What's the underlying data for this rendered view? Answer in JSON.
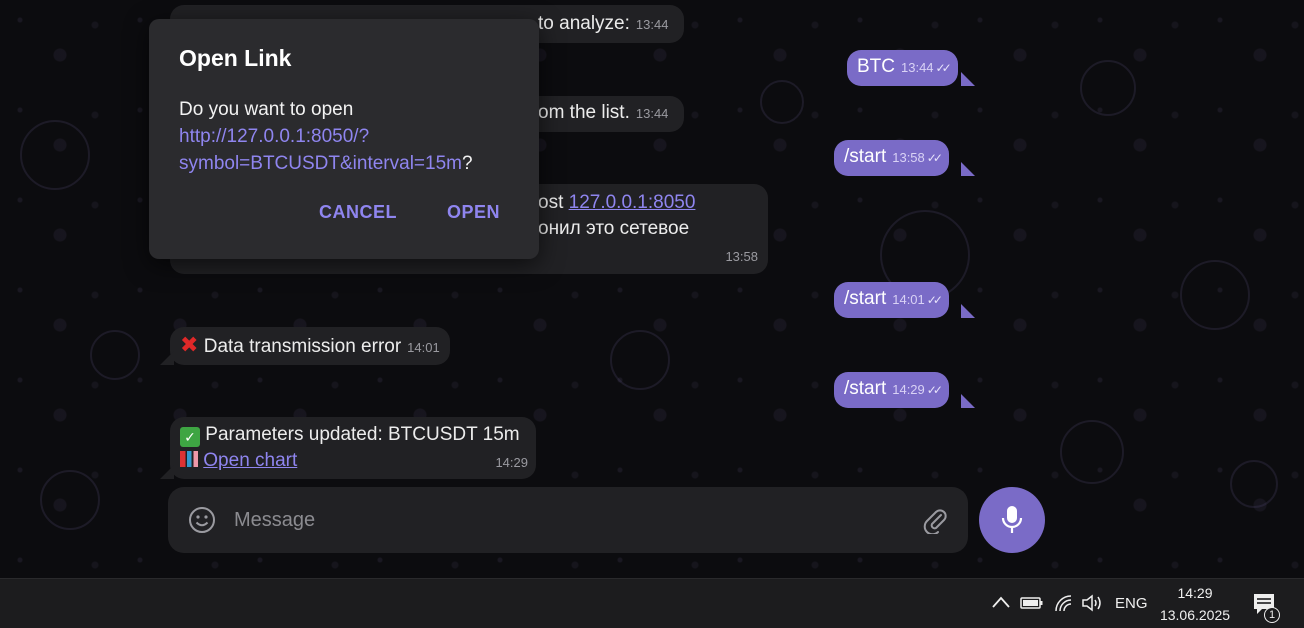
{
  "messages": {
    "top_partial": {
      "text": "to analyze:",
      "time": "13:44"
    },
    "second_partial": {
      "text": "om the list.",
      "time": "13:44"
    },
    "host_msg": {
      "prefix": "ost ",
      "link": "127.0.0.1:8050",
      "line2": "онил это сетевое",
      "time": "13:58"
    },
    "out_btc": {
      "text": "BTC",
      "time": "13:44"
    },
    "out_start1": {
      "text": "/start",
      "time": "13:58"
    },
    "out_start2": {
      "text": "/start",
      "time": "14:01"
    },
    "out_start3": {
      "text": "/start",
      "time": "14:29"
    },
    "error": {
      "text": "Data transmission error",
      "time": "14:01"
    },
    "params": {
      "line1": "Parameters updated: BTCUSDT 15m",
      "link": "Open chart",
      "time": "14:29"
    }
  },
  "composer": {
    "placeholder": "Message"
  },
  "dialog": {
    "title": "Open Link",
    "question": "Do you want to open",
    "url_line1": "http://127.0.0.1:8050/?",
    "url_line2": "symbol=BTCUSDT&interval=15m",
    "question_mark": "?",
    "cancel": "CANCEL",
    "open": "OPEN"
  },
  "taskbar": {
    "lang": "ENG",
    "time": "14:29",
    "date": "13.06.2025",
    "notif_count": "1"
  },
  "colors": {
    "accent": "#7a6bc7",
    "link": "#8f85ef",
    "bubble_in": "#212124"
  },
  "icons": [
    "emoji-icon",
    "attach-icon",
    "mic-icon",
    "double-check-icon",
    "cross-mark-icon",
    "check-mark-icon",
    "chart-icon",
    "chevron-up-icon",
    "battery-icon",
    "wifi-icon",
    "volume-icon",
    "notification-icon"
  ]
}
